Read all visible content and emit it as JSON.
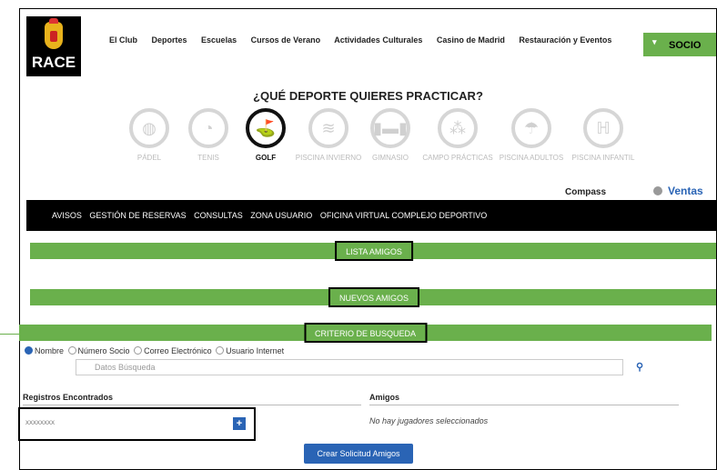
{
  "brand": {
    "logo_text": "RACE"
  },
  "nav": {
    "items": [
      "El Club",
      "Deportes",
      "Escuelas",
      "Cursos de Verano",
      "Actividades Culturales",
      "Casino de Madrid",
      "Restauración y Eventos"
    ]
  },
  "socio": {
    "label": "SOCIO"
  },
  "question": "¿QUÉ DEPORTE QUIERES PRACTICAR?",
  "sports": [
    {
      "name": "PÁDEL",
      "icon": "padel-icon",
      "active": false
    },
    {
      "name": "TENIS",
      "icon": "tennis-icon",
      "active": false
    },
    {
      "name": "GOLF",
      "icon": "golf-icon",
      "active": true
    },
    {
      "name": "PISCINA INVIERNO",
      "icon": "swimming-icon",
      "active": false
    },
    {
      "name": "GIMNASIO",
      "icon": "dumbbell-icon",
      "active": false
    },
    {
      "name": "CAMPO PRÁCTICAS",
      "icon": "golf-balls-icon",
      "active": false
    },
    {
      "name": "PISCINA ADULTOS",
      "icon": "beach-umbrella-icon",
      "active": false
    },
    {
      "name": "PISCINA INFANTIL",
      "icon": "pool-ladder-icon",
      "active": false
    }
  ],
  "toolbar": {
    "compass": "Compass",
    "ventas": "Ventas"
  },
  "blackbar": {
    "items": [
      "AVISOS",
      "GESTIÓN DE RESERVAS",
      "CONSULTAS",
      "ZONA USUARIO",
      "OFICINA VIRTUAL COMPLEJO DEPORTIVO"
    ]
  },
  "sections": {
    "lista": "LISTA AMIGOS",
    "nuevos": "NUEVOS AMIGOS",
    "criterio": "CRITERIO DE BUSQUEDA"
  },
  "search": {
    "options": [
      "Nombre",
      "Número Socio",
      "Correo Electrónico",
      "Usuario Internet"
    ],
    "selected": "Nombre",
    "placeholder": "Datos Búsqueda"
  },
  "results": {
    "found_header": "Registros Encontrados",
    "friends_header": "Amigos",
    "found_value": "XXXXXXXX",
    "empty_text": "No hay jugadores seleccionados",
    "add_label": "+"
  },
  "actions": {
    "crear": "Crear Solicitud Amigos"
  },
  "colors": {
    "green": "#6ab04c",
    "blue": "#2a64b5"
  }
}
